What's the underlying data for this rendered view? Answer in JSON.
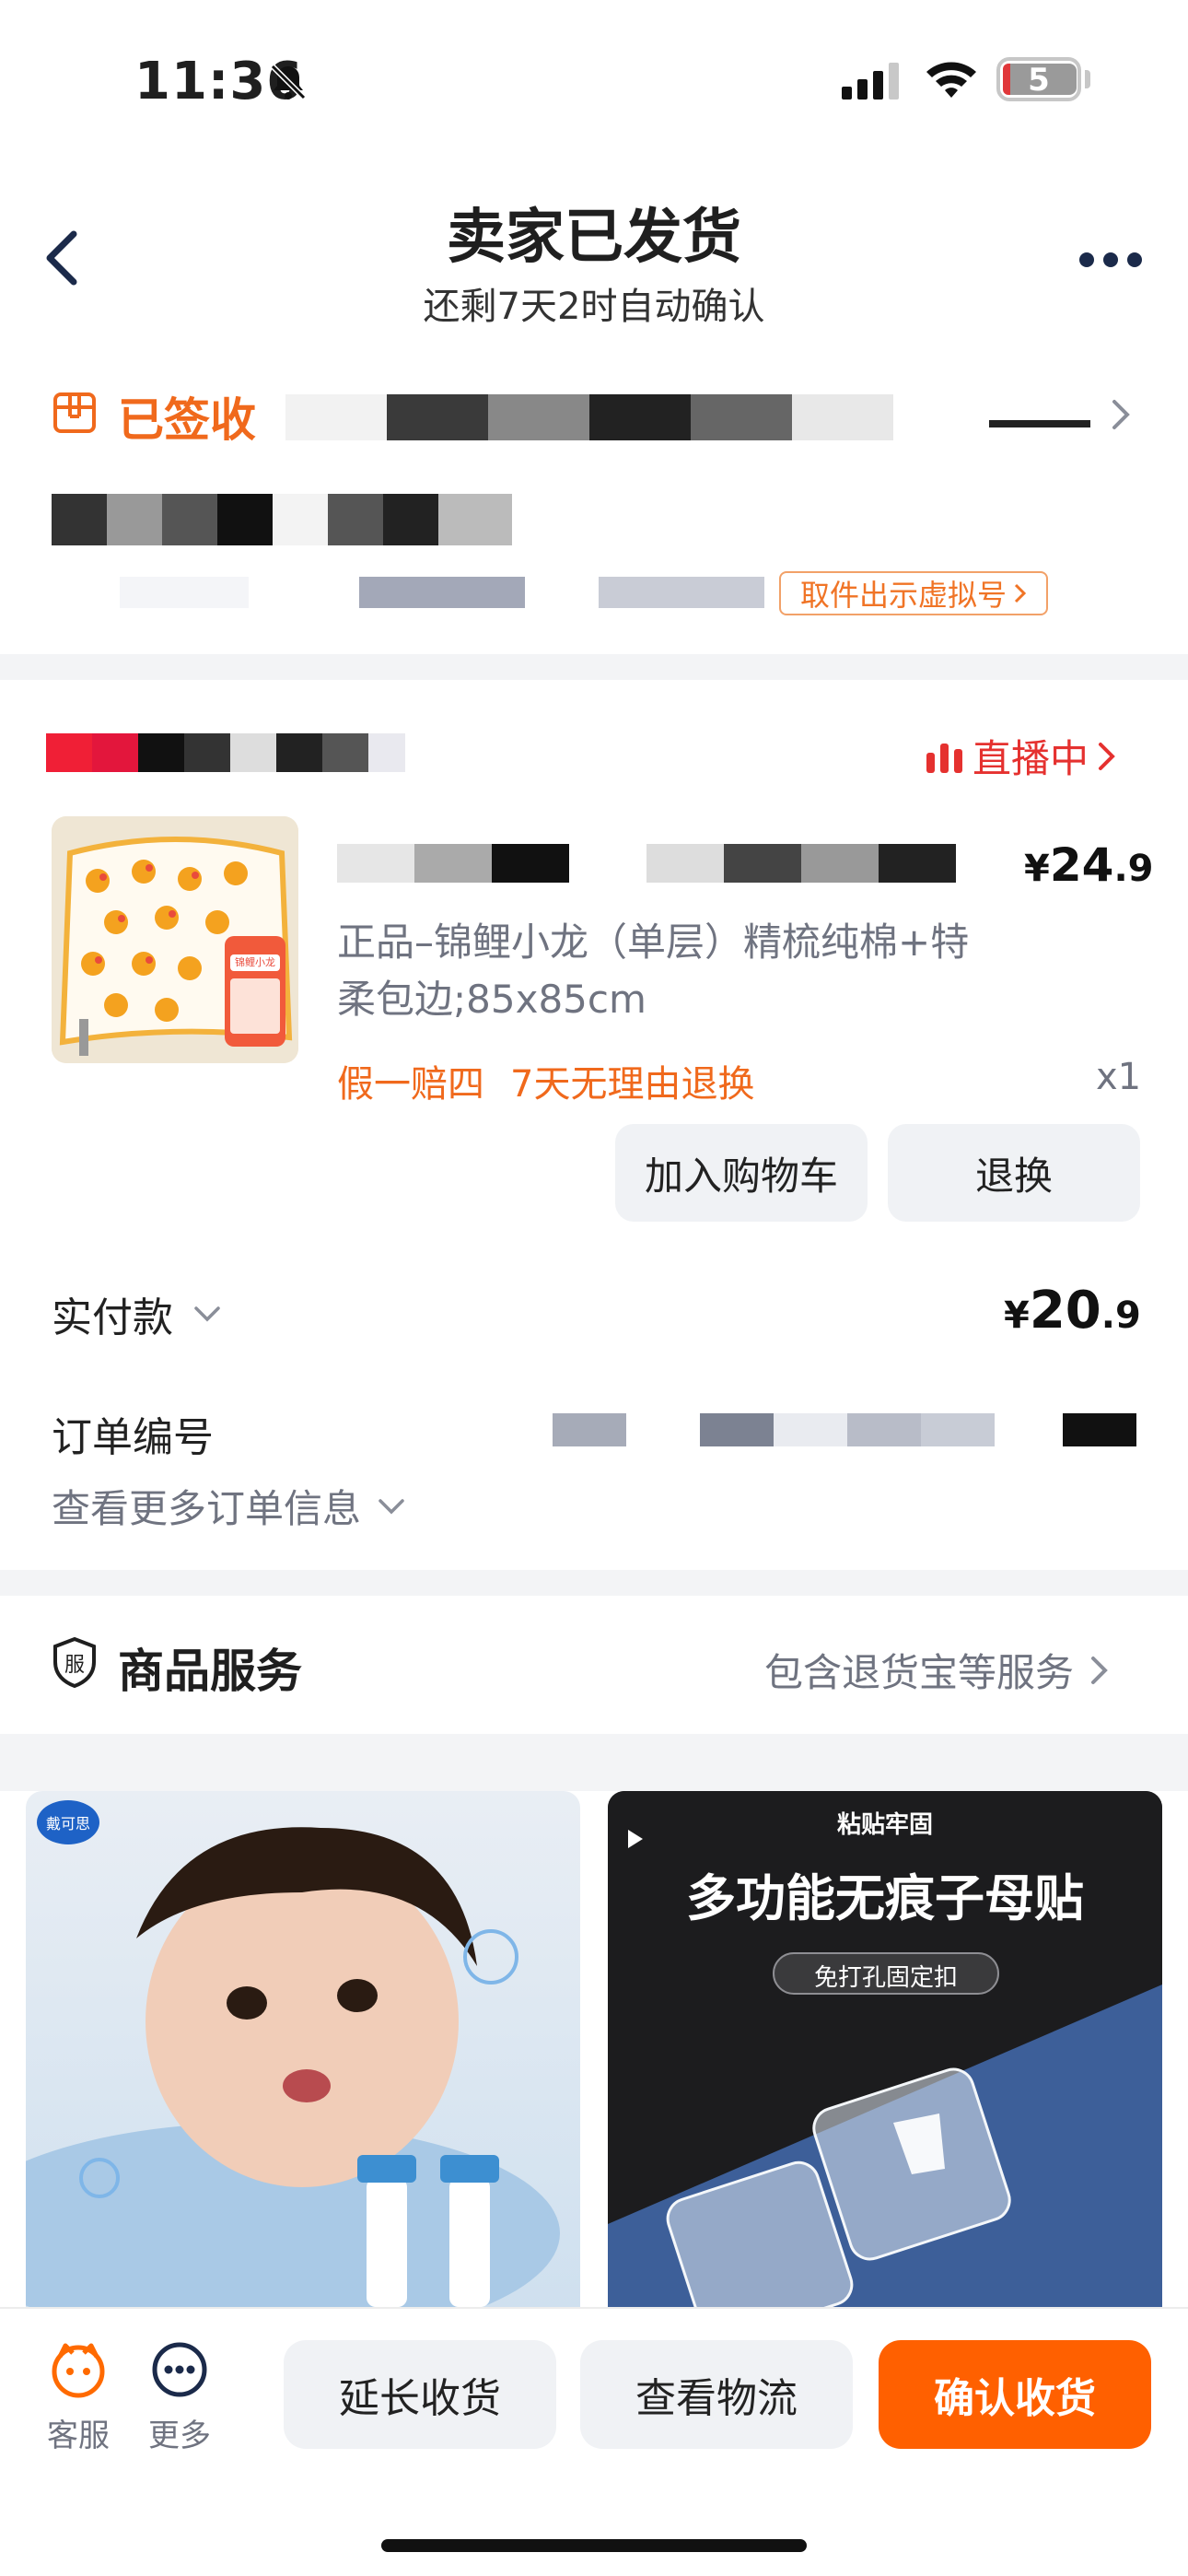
{
  "status_bar": {
    "time": "11:36",
    "battery": "5"
  },
  "header": {
    "title": "卖家已发货",
    "subtitle": "还剩7天2时自动确认"
  },
  "logistics": {
    "status": "已签收",
    "pickup_button": "取件出示虚拟号",
    "accent_color": "#f0691c"
  },
  "shop": {
    "live_label": "直播中",
    "live_color": "#e5312f"
  },
  "product": {
    "price": {
      "currency": "¥",
      "int": "24",
      "dec": ".9"
    },
    "sku": "正品–锦鲤小龙（单层）精梳纯棉+特柔包边;85x85cm",
    "tags": [
      "假一赔四",
      "7天无理由退换"
    ],
    "quantity": "x1",
    "image_label": "锦鲤小龙",
    "add_to_cart": "加入购物车",
    "return_exchange": "退换"
  },
  "payment": {
    "label": "实付款",
    "price": {
      "currency": "¥",
      "int": "20",
      "dec": ".9"
    }
  },
  "order": {
    "number_label": "订单编号",
    "more_info": "查看更多订单信息"
  },
  "service": {
    "icon_char": "服",
    "title": "商品服务",
    "desc": "包含退货宝等服务"
  },
  "recommendations": [
    {
      "badge": "戴可思"
    },
    {
      "top_label": "粘贴牢固",
      "headline": "多功能无痕子母贴",
      "pill": "免打孔固定扣"
    }
  ],
  "bottom_bar": {
    "service": "客服",
    "more": "更多",
    "extend": "延长收货",
    "logistics": "查看物流",
    "confirm": "确认收货",
    "confirm_color": "#ff6000"
  }
}
